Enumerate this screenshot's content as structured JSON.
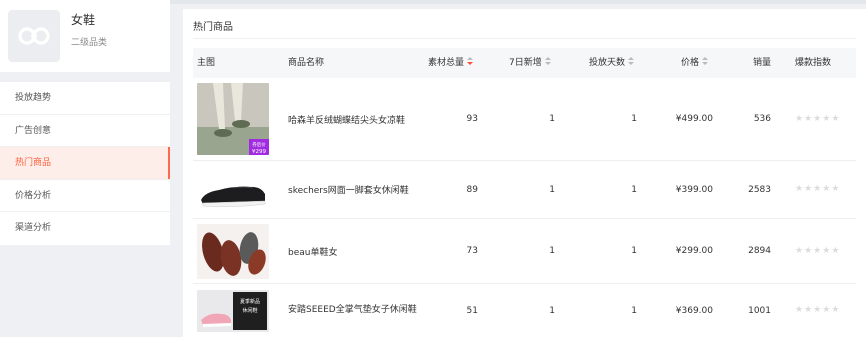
{
  "category": {
    "title": "女鞋",
    "subtitle": "二级品类",
    "logo_icon": "link-logo-icon"
  },
  "nav": {
    "items": [
      {
        "label": "投放趋势",
        "active": false
      },
      {
        "label": "广告创意",
        "active": false
      },
      {
        "label": "热门商品",
        "active": true
      },
      {
        "label": "价格分析",
        "active": false
      },
      {
        "label": "渠道分析",
        "active": false
      }
    ]
  },
  "panel": {
    "title": "热门商品"
  },
  "table": {
    "headers": {
      "image": "主图",
      "name": "商品名称",
      "materials": "素材总量",
      "new7d": "7日新增",
      "days": "投放天数",
      "price": "价格",
      "sales": "销量",
      "hot": "爆款指数"
    },
    "sort_active": "materials",
    "sort_direction": "desc",
    "rows": [
      {
        "name": "哈森羊反绒蝴蝶结尖头女凉鞋",
        "materials": "93",
        "new7d": "1",
        "days": "1",
        "price": "¥499.00",
        "sales": "536",
        "hot": 0,
        "badge_top": "券后价",
        "badge_price": "¥299"
      },
      {
        "name": "skechers网面一脚套女休闲鞋",
        "materials": "89",
        "new7d": "1",
        "days": "1",
        "price": "¥399.00",
        "sales": "2583",
        "hot": 0
      },
      {
        "name": "beau单鞋女",
        "materials": "73",
        "new7d": "1",
        "days": "1",
        "price": "¥299.00",
        "sales": "2894",
        "hot": 0
      },
      {
        "name": "安踏SEEED全掌气垫女子休闲鞋",
        "materials": "51",
        "new7d": "1",
        "days": "1",
        "price": "¥369.00",
        "sales": "1001",
        "hot": 0,
        "badge_top": "夏季新品",
        "badge_price": "休闲鞋"
      }
    ]
  },
  "colors": {
    "accent": "#ff5f3d",
    "active_bg": "#fdeeea",
    "star_empty": "#dcdcdc",
    "badge_purple": "#a12be0"
  }
}
